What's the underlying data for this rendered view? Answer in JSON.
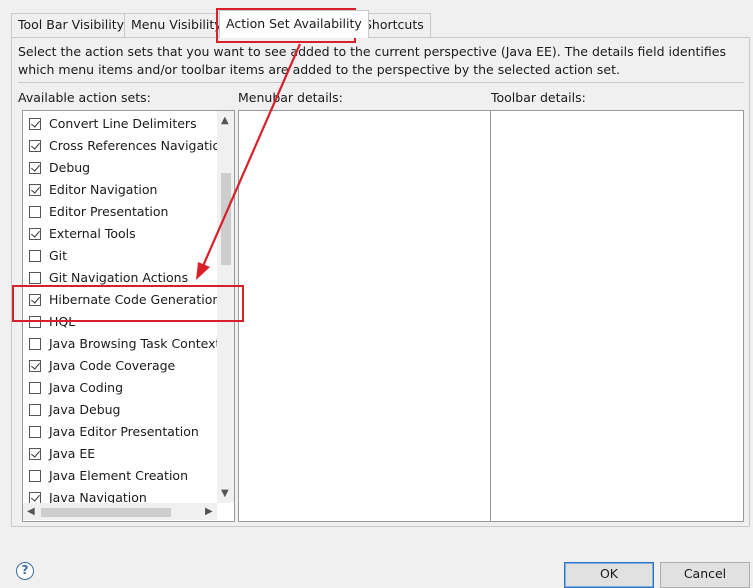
{
  "tabs": [
    {
      "label": "Tool Bar Visibility",
      "active": false
    },
    {
      "label": "Menu Visibility",
      "active": false
    },
    {
      "label": "Action Set Availability",
      "active": true
    },
    {
      "label": "Shortcuts",
      "active": false
    }
  ],
  "description": "Select the action sets that you want to see added to the current perspective (Java EE).  The details field identifies which menu items and/or toolbar items are added to the perspective by the selected action set.",
  "labels": {
    "available": "Available action sets:",
    "menubar": "Menubar details:",
    "toolbar": "Toolbar details:"
  },
  "action_sets": [
    {
      "label": "Convert Line Delimiters",
      "checked": true
    },
    {
      "label": "Cross References Navigation",
      "checked": true
    },
    {
      "label": "Debug",
      "checked": true
    },
    {
      "label": "Editor Navigation",
      "checked": true
    },
    {
      "label": "Editor Presentation",
      "checked": false
    },
    {
      "label": "External Tools",
      "checked": true
    },
    {
      "label": "Git",
      "checked": false
    },
    {
      "label": "Git Navigation Actions",
      "checked": false
    },
    {
      "label": "Hibernate Code Generation",
      "checked": true
    },
    {
      "label": "HQL",
      "checked": false
    },
    {
      "label": "Java Browsing Task Context",
      "checked": false
    },
    {
      "label": "Java Code Coverage",
      "checked": true
    },
    {
      "label": "Java Coding",
      "checked": false
    },
    {
      "label": "Java Debug",
      "checked": false
    },
    {
      "label": "Java Editor Presentation",
      "checked": false
    },
    {
      "label": "Java EE",
      "checked": true
    },
    {
      "label": "Java Element Creation",
      "checked": false
    },
    {
      "label": "Java Navigation",
      "checked": true
    }
  ],
  "buttons": {
    "help": "?",
    "ok": "OK",
    "cancel": "Cancel"
  },
  "annotation_color": "#d9202a"
}
